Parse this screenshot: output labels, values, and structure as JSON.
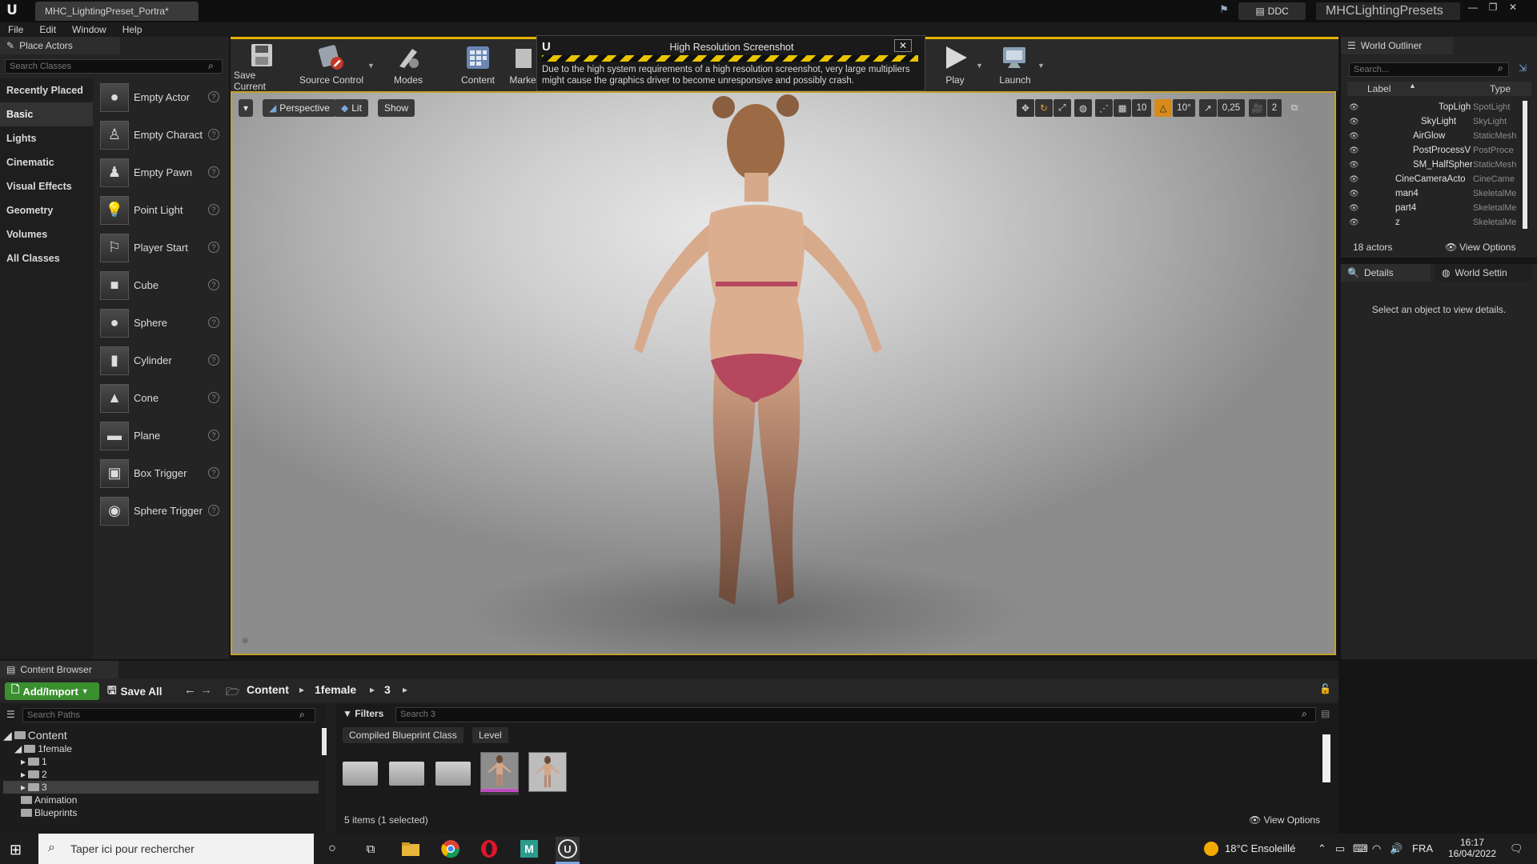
{
  "titlebar": {
    "document_tab": "MHC_LightingPreset_Portra*",
    "ddc_label": "DDC",
    "project_name": "MHCLightingPresets"
  },
  "menu": [
    "File",
    "Edit",
    "Window",
    "Help"
  ],
  "place_actors": {
    "tab_label": "Place Actors",
    "search_placeholder": "Search Classes",
    "categories": [
      "Recently Placed",
      "Basic",
      "Lights",
      "Cinematic",
      "Visual Effects",
      "Geometry",
      "Volumes",
      "All Classes"
    ],
    "active_category": "Basic",
    "actors": [
      {
        "label": "Empty Actor",
        "icon": "sphere-icon"
      },
      {
        "label": "Empty Charact",
        "icon": "character-icon"
      },
      {
        "label": "Empty Pawn",
        "icon": "pawn-icon"
      },
      {
        "label": "Point Light",
        "icon": "light-bulb-icon"
      },
      {
        "label": "Player Start",
        "icon": "player-start-icon"
      },
      {
        "label": "Cube",
        "icon": "cube-icon"
      },
      {
        "label": "Sphere",
        "icon": "sphere-icon"
      },
      {
        "label": "Cylinder",
        "icon": "cylinder-icon"
      },
      {
        "label": "Cone",
        "icon": "cone-icon"
      },
      {
        "label": "Plane",
        "icon": "plane-icon"
      },
      {
        "label": "Box Trigger",
        "icon": "box-trigger-icon"
      },
      {
        "label": "Sphere Trigger",
        "icon": "sphere-trigger-icon"
      }
    ]
  },
  "toolbar": {
    "save_current": "Save Current",
    "source_control": "Source Control",
    "modes": "Modes",
    "content": "Content",
    "marketplace": "Marke",
    "play": "Play",
    "launch": "Launch"
  },
  "notification": {
    "title": "High Resolution Screenshot",
    "message": "Due to the high system requirements of a high resolution screenshot, very large multipliers might cause the graphics driver to become unresponsive and possibly crash."
  },
  "viewport": {
    "perspective": "Perspective",
    "lit": "Lit",
    "show": "Show",
    "grid_snap": "10",
    "rotation_snap": "10°",
    "scale_snap": "0,25",
    "camera_speed": "2",
    "colors": {
      "border": "#c7a028",
      "skin": "#d9a98c",
      "bikini": "#b5485e"
    }
  },
  "world_outliner": {
    "tab_label": "World Outliner",
    "search_placeholder": "Search...",
    "col_label": "Label",
    "col_type": "Type",
    "rows": [
      {
        "label": "TopLigh",
        "type": "SpotLight",
        "indent": 3
      },
      {
        "label": "SkyLight",
        "type": "SkyLight",
        "indent": 2
      },
      {
        "label": "AirGlow",
        "type": "StaticMesh",
        "indent": 1
      },
      {
        "label": "PostProcessV",
        "type": "PostProce",
        "indent": 1
      },
      {
        "label": "SM_HalfSpher",
        "type": "StaticMesh",
        "indent": 1
      },
      {
        "label": "CineCameraActo",
        "type": "CineCame",
        "indent": 0
      },
      {
        "label": "man4",
        "type": "SkeletalMe",
        "indent": 0
      },
      {
        "label": "part4",
        "type": "SkeletalMe",
        "indent": 0
      },
      {
        "label": "z",
        "type": "SkeletalMe",
        "indent": 0
      }
    ],
    "actor_count": "18 actors",
    "view_options": "View Options"
  },
  "details": {
    "tab_details": "Details",
    "tab_world_settings": "World Settin",
    "empty_message": "Select an object to view details."
  },
  "content_browser": {
    "tab_label": "Content Browser",
    "add_import": "Add/Import",
    "save_all": "Save All",
    "breadcrumb": [
      "Content",
      "1female",
      "3"
    ],
    "paths_placeholder": "Search Paths",
    "tree": [
      {
        "label": "Content",
        "level": 0
      },
      {
        "label": "1female",
        "level": 1
      },
      {
        "label": "1",
        "level": 2
      },
      {
        "label": "2",
        "level": 2
      },
      {
        "label": "3",
        "level": 2,
        "selected": true
      },
      {
        "label": "Animation",
        "level": 1
      },
      {
        "label": "Blueprints",
        "level": 1
      }
    ],
    "filters": "Filters",
    "asset_search_placeholder": "Search 3",
    "filter_chips": [
      "Compiled Blueprint Class",
      "Level"
    ],
    "status": "5 items (1 selected)",
    "view_options": "View Options"
  },
  "taskbar": {
    "search_placeholder": "Taper ici pour rechercher",
    "weather": "18°C Ensoleillé",
    "language": "FRA",
    "time": "16:17",
    "date": "16/04/2022"
  }
}
